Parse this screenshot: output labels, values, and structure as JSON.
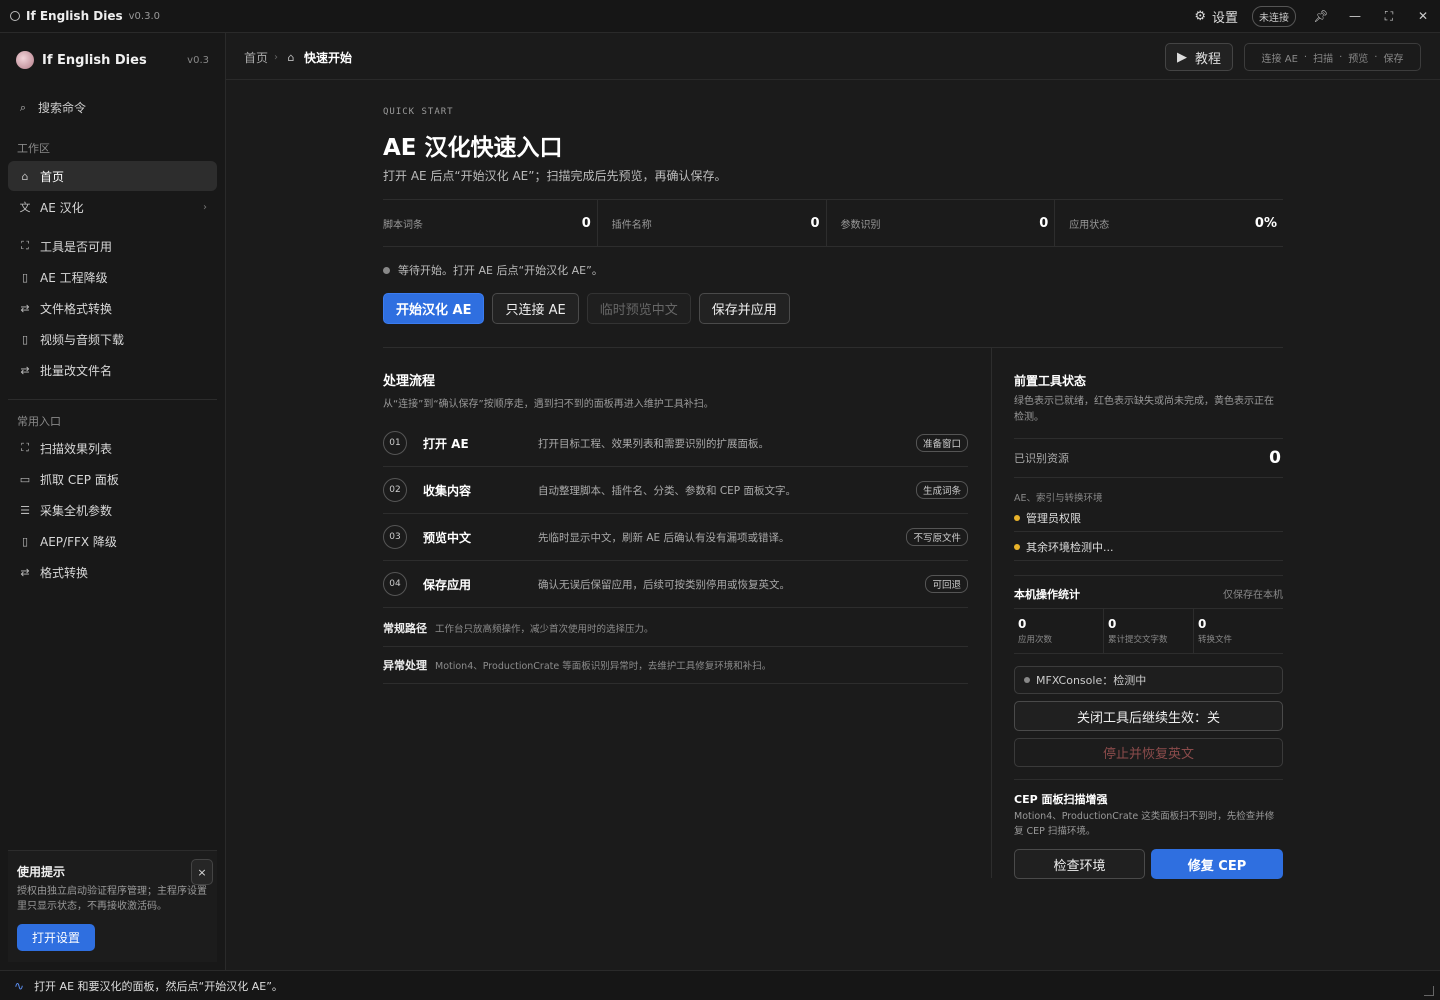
{
  "window": {
    "app_name": "If English Dies",
    "version": "v0.3.0",
    "settings_label": "设置",
    "connection_badge": "未连接"
  },
  "sidebar": {
    "brand_name": "If English Dies",
    "brand_version": "v0.3",
    "search_label": "搜索命令",
    "section_workspace": "工作区",
    "section_common": "常用入口",
    "workspace_items": [
      {
        "label": "首页",
        "icon": "home-icon"
      },
      {
        "label": "AE 汉化",
        "icon": "translate-icon"
      },
      {
        "label": "工具是否可用",
        "icon": "scan-icon"
      },
      {
        "label": "AE 工程降级",
        "icon": "file-down-icon"
      },
      {
        "label": "文件格式转换",
        "icon": "convert-icon"
      },
      {
        "label": "视频与音频下载",
        "icon": "file-down-icon"
      },
      {
        "label": "批量改文件名",
        "icon": "convert-icon"
      }
    ],
    "common_items": [
      {
        "label": "扫描效果列表",
        "icon": "scan-icon"
      },
      {
        "label": "抓取 CEP 面板",
        "icon": "panel-icon"
      },
      {
        "label": "采集全机参数",
        "icon": "database-icon"
      },
      {
        "label": "AEP/FFX 降级",
        "icon": "file-down-icon"
      },
      {
        "label": "格式转换",
        "icon": "convert-icon"
      }
    ],
    "tip": {
      "title": "使用提示",
      "close": "×",
      "body": "授权由独立启动验证程序管理；主程序设置里只显示状态，不再接收激活码。",
      "button": "打开设置"
    }
  },
  "topbar": {
    "crumb_home": "首页",
    "crumb_sep": "›",
    "crumb_current": "快速开始",
    "tutorial_label": "教程",
    "steps": [
      "连接 AE",
      "扫描",
      "预览",
      "保存"
    ],
    "steps_sep": "·"
  },
  "main": {
    "eyebrow": "QUICK START",
    "title": "AE 汉化快速入口",
    "subtitle": "打开 AE 后点“开始汉化 AE”；扫描完成后先预览，再确认保存。",
    "stats": [
      {
        "label": "脚本词条",
        "value": "0"
      },
      {
        "label": "插件名称",
        "value": "0"
      },
      {
        "label": "参数识别",
        "value": "0"
      },
      {
        "label": "应用状态",
        "value": "0%"
      }
    ],
    "waiting": "等待开始。打开 AE 后点“开始汉化 AE”。",
    "buttons": {
      "start": "开始汉化 AE",
      "connect": "只连接 AE",
      "preview": "临时预览中文",
      "save": "保存并应用"
    },
    "process": {
      "title": "处理流程",
      "subtitle": "从“连接”到“确认保存”按顺序走，遇到扫不到的面板再进入维护工具补扫。",
      "steps": [
        {
          "num": "01",
          "title": "打开 AE",
          "desc": "打开目标工程、效果列表和需要识别的扩展面板。",
          "tag": "准备窗口"
        },
        {
          "num": "02",
          "title": "收集内容",
          "desc": "自动整理脚本、插件名、分类、参数和 CEP 面板文字。",
          "tag": "生成词条"
        },
        {
          "num": "03",
          "title": "预览中文",
          "desc": "先临时显示中文，刷新 AE 后确认有没有漏项或错译。",
          "tag": "不写原文件"
        },
        {
          "num": "04",
          "title": "保存应用",
          "desc": "确认无误后保留应用，后续可按类别停用或恢复英文。",
          "tag": "可回退"
        }
      ],
      "notes": [
        {
          "label": "常规路径",
          "text": "工作台只放高频操作，减少首次使用时的选择压力。"
        },
        {
          "label": "异常处理",
          "text": "Motion4、ProductionCrate 等面板识别异常时，去维护工具修复环境和补扫。"
        }
      ]
    }
  },
  "panel": {
    "title": "前置工具状态",
    "desc": "绿色表示已就绪，红色表示缺失或尚未完成，黄色表示正在检测。",
    "resources_label": "已识别资源",
    "resources_value": "0",
    "env_label": "AE、索引与转换环境",
    "env_items": [
      "管理员权限",
      "其余环境检测中..."
    ],
    "stats_title": "本机操作统计",
    "stats_note": "仅保存在本机",
    "stats": [
      {
        "value": "0",
        "label": "应用次数"
      },
      {
        "value": "0",
        "label": "累计提交文字数"
      },
      {
        "value": "0",
        "label": "转换文件"
      }
    ],
    "console": "MFXConsole：检测中",
    "close_tool": "关闭工具后继续生效：关",
    "stop_restore": "停止并恢复英文",
    "cep_title": "CEP 面板扫描增强",
    "cep_desc": "Motion4、ProductionCrate 这类面板扫不到时，先检查并修复 CEP 扫描环境。",
    "check_env": "检查环境",
    "fix_cep": "修复 CEP"
  },
  "statusbar": {
    "text": "打开 AE 和要汉化的面板，然后点“开始汉化 AE”。"
  }
}
